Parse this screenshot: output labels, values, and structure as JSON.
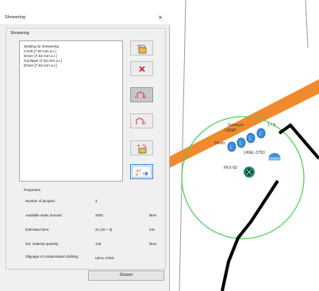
{
  "dialog": {
    "title": "Showering",
    "group_label": "Showering",
    "list_items": [
      "Waiting for showering",
      "Credt [7.62 mm a.r.]",
      "Driver [7.62 mm a.r.]",
      "Gunlayer [7.62 mm a.r.]",
      "Driver [7.62 mm a.r.]"
    ],
    "toolbar_icons": [
      "add-to-shower-icon",
      "remove-icon",
      "shower-persons-icon",
      "unload-persons-icon",
      "add-material-icon",
      "shower-all-icon"
    ],
    "properties": {
      "title": "Properties",
      "rows": [
        {
          "label": "Number of peoples:",
          "value": "4",
          "unit": ""
        },
        {
          "label": "Available water amount:",
          "value": "2000",
          "unit": "litres"
        },
        {
          "label": "Estimated time:",
          "value": "21 (16 + 5)",
          "unit": "min"
        },
        {
          "label": "Est. material quantity:",
          "value": "146",
          "unit": "litres"
        },
        {
          "label": "Slippage of contaminated clothing:",
          "value": "URAL-375D",
          "unit": ""
        }
      ]
    },
    "shower_button": "Shower"
  },
  "map": {
    "labels": {
      "surveyor": "Surveyor",
      "driver": "Driver",
      "crew_a": "CRMP",
      "ural": "URAL-375D",
      "unit_id": "FKX-50",
      "tag": "1 / 3"
    },
    "colors": {
      "road": "#f08a2c",
      "radius": "#49d04d",
      "track": "#000000",
      "unit_blue": "#3a8fe0",
      "unit_teal": "#1e8a6e"
    }
  }
}
